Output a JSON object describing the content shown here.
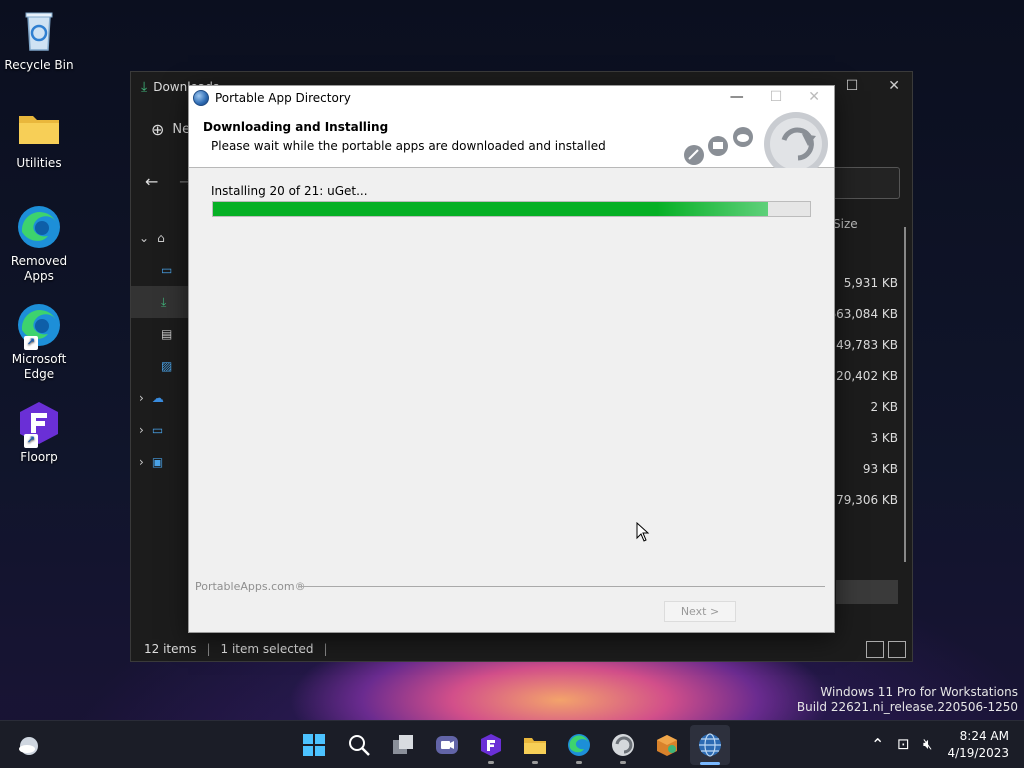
{
  "desktop": {
    "icons": [
      {
        "label": "Recycle Bin"
      },
      {
        "label": "Utilities"
      },
      {
        "label": "Removed Apps"
      },
      {
        "label": "Microsoft Edge"
      },
      {
        "label": "Floorp"
      }
    ],
    "watermark_line1": "Windows 11 Pro for Workstations",
    "watermark_line2": "Build 22621.ni_release.220506-1250"
  },
  "explorer": {
    "title": "Downloads",
    "new_label": "New",
    "size_header": "Size",
    "sizes": [
      "5,931 KB",
      "663,084 KB",
      "49,783 KB",
      "120,402 KB",
      "2 KB",
      "3 KB",
      "93 KB",
      "79,306 KB"
    ],
    "status_items": "12 items",
    "status_selected": "1 item selected"
  },
  "dialog": {
    "title": "Portable App Directory",
    "heading": "Downloading and Installing",
    "subheading": "Please wait while the portable apps are downloaded and installed",
    "install_status": "Installing 20 of 21: uGet...",
    "progress": 0.93,
    "brand": "PortableApps.com®",
    "next_label": "Next >"
  },
  "taskbar": {
    "time": "8:24 AM",
    "date": "4/19/2023",
    "accent": "#79b8ff"
  },
  "colors": {
    "progress_green": "#06b025",
    "dialog_bg": "#f0f0f0"
  }
}
